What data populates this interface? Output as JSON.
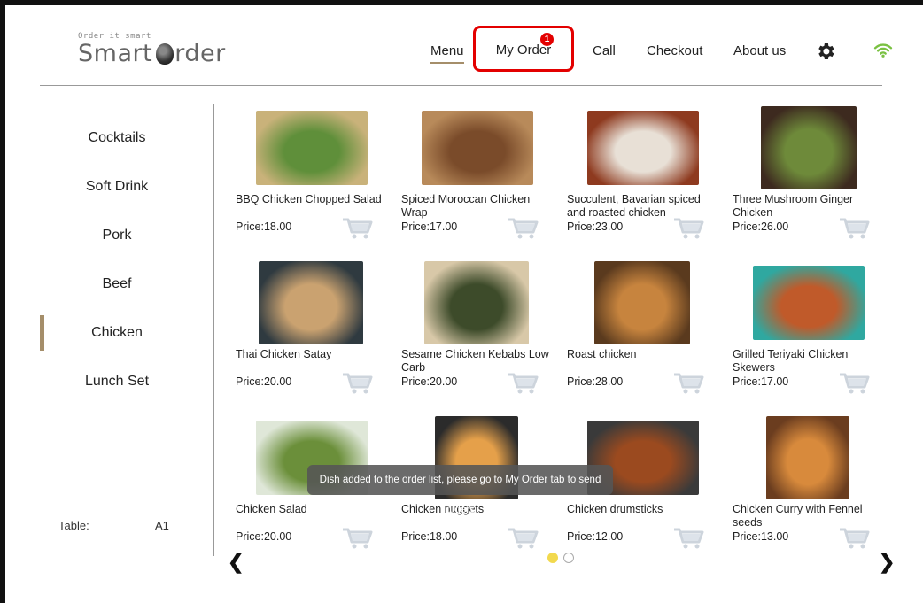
{
  "header": {
    "logo_tagline": "Order it smart",
    "logo_name_pre": "Smart",
    "logo_name_post": "rder",
    "nav": {
      "menu": "Menu",
      "my_order": "My Order",
      "my_order_badge": "1",
      "call": "Call",
      "checkout": "Checkout",
      "about": "About us"
    },
    "icons": [
      "gear-icon",
      "wifi-icon"
    ]
  },
  "sidebar": {
    "categories": [
      "Cocktails",
      "Soft Drink",
      "Pork",
      "Beef",
      "Chicken",
      "Lunch Set"
    ],
    "selected": "Chicken",
    "table_label": "Table:",
    "table_value": "A1"
  },
  "items": [
    {
      "title": "BBQ Chicken Chopped Salad",
      "price": "Price:18.00"
    },
    {
      "title": "Spiced Moroccan Chicken Wrap",
      "price": "Price:17.00"
    },
    {
      "title": "Succulent, Bavarian spiced and roasted chicken",
      "price": "Price:23.00"
    },
    {
      "title": "Three Mushroom Ginger Chicken",
      "price": "Price:26.00"
    },
    {
      "title": "Thai Chicken Satay",
      "price": "Price:20.00"
    },
    {
      "title": "Sesame Chicken Kebabs Low Carb",
      "price": "Price:20.00"
    },
    {
      "title": "Roast chicken",
      "price": "Price:28.00"
    },
    {
      "title": "Grilled Teriyaki Chicken Skewers",
      "price": "Price:17.00"
    },
    {
      "title": "Chicken Salad",
      "price": "Price:20.00"
    },
    {
      "title": "Chicken nuggets",
      "price": "Price:18.00"
    },
    {
      "title": "Chicken drumsticks",
      "price": "Price:12.00"
    },
    {
      "title": "Chicken Curry with Fennel seeds",
      "price": "Price:13.00"
    }
  ],
  "toast": "Dish added to the order list, please go to My Order tab to send orders",
  "pagination": {
    "current_page": 1,
    "total_pages": 2
  },
  "colors": {
    "accent": "#a58e6a",
    "highlight": "#e30000",
    "wifi": "#7ac142",
    "active_dot": "#f2d94e"
  }
}
